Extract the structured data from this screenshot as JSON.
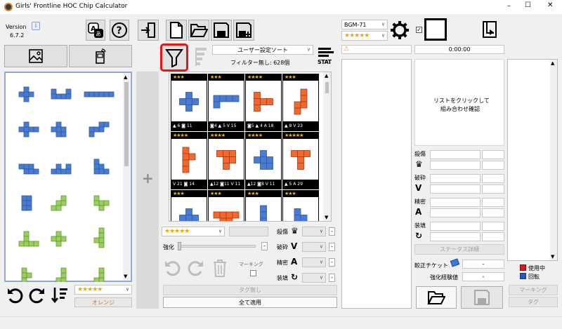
{
  "window": {
    "title": "Girls' Frontline HOC Chip Calculator",
    "minimize": "–",
    "maximize": "☐",
    "close": "✕"
  },
  "version": {
    "label": "Version",
    "number": "6.7.2"
  },
  "filter": {
    "sort_label": "ユーザー設定ソート",
    "count_text": "フィルター無し: 628個",
    "stat_label": "STAT"
  },
  "character": {
    "name": "BGM-71",
    "stars": "★★★★★"
  },
  "hoc_stars": "★★★★★",
  "time": "0:00:00",
  "cards": [
    {
      "stars": "★★★",
      "footer": "▲ 6 ◙ 11"
    },
    {
      "stars": "★★★",
      "footer": "◙4 ▲ 5 V 15"
    },
    {
      "stars": "★★★★",
      "footer": "◙5 ▲ 4 A 18"
    },
    {
      "stars": "★★★",
      "footer": "▲ 8 V 23"
    },
    {
      "stars": "★★★★",
      "footer": "V 21 ◙ 14"
    },
    {
      "stars": "★★★★",
      "footer": "▲12 ◙11 V 11"
    },
    {
      "stars": "★★★★",
      "footer": "▲12 ◙8 V 11"
    },
    {
      "stars": "★★★★★",
      "footer": "▲ 5 A 29"
    },
    {
      "stars": "★★★",
      "footer": ""
    },
    {
      "stars": "★★★",
      "footer": ""
    },
    {
      "stars": "★★★",
      "footer": ""
    },
    {
      "stars": "★★★",
      "footer": ""
    }
  ],
  "controls": {
    "stars": "★★★★★",
    "enhance_label": "強化",
    "marking_label": "マーキング",
    "stat_rows": [
      {
        "label": "殺傷"
      },
      {
        "label": "破砕"
      },
      {
        "label": "精密"
      },
      {
        "label": "装填"
      }
    ],
    "tag_none": "タグ無し",
    "apply_all": "全て適用"
  },
  "left": {
    "stars": "★★★★★",
    "color": "オレンジ"
  },
  "right": {
    "hint_line1": "リストをクリックして",
    "hint_line2": "組み合わせ確認",
    "stats": [
      {
        "label": "殺傷"
      },
      {
        "label": "破砕"
      },
      {
        "label": "精密"
      },
      {
        "label": "装填"
      }
    ],
    "status_button": "ステータス詳細",
    "ticket_label": "較正チケット",
    "ticket_value": "-",
    "exp_label": "強化経験値",
    "exp_value": "-",
    "legend_in_use": "使用中",
    "legend_rotate": "回転",
    "marking_button": "マーキング",
    "tag_button": "タグ"
  },
  "colors": {
    "blue": "#4a7bd0",
    "green": "#9bd060",
    "orange": "#f06a30",
    "star": "#f3b800",
    "highlight": "#e01818"
  }
}
